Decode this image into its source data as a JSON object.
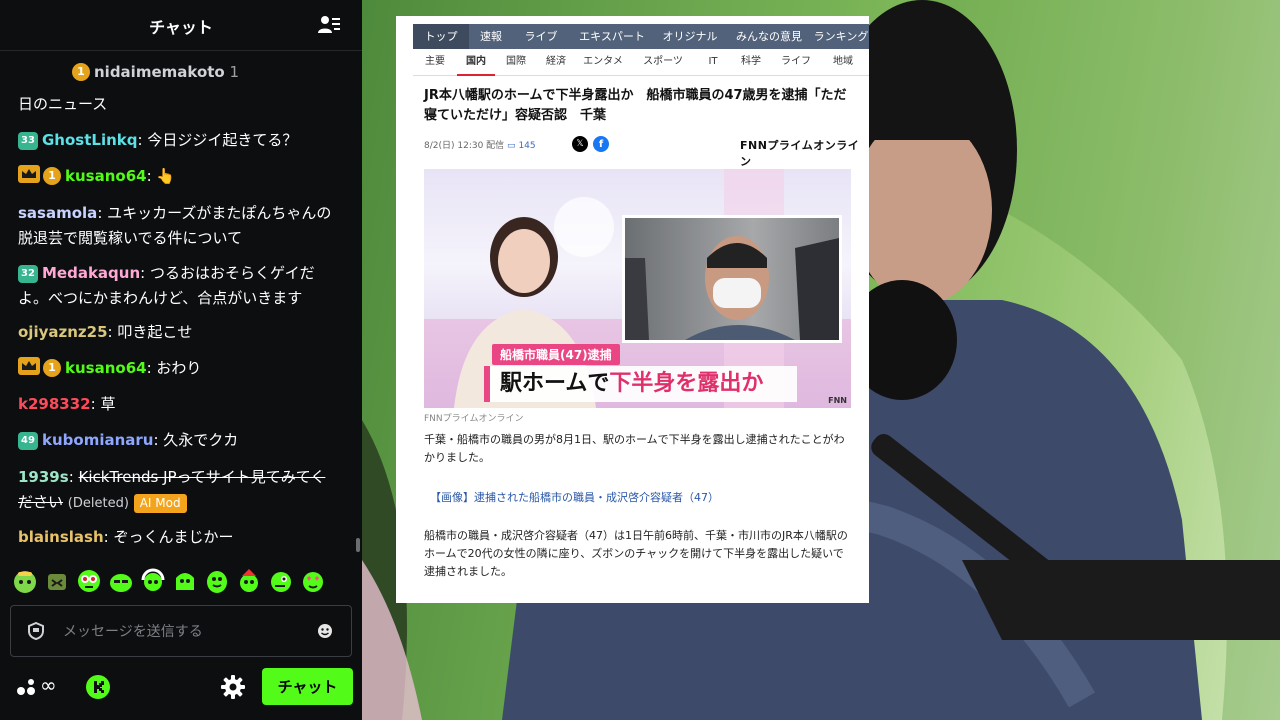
{
  "chat": {
    "title": "チャット",
    "messages": [
      {
        "badges": [
          {
            "type": "gift",
            "text": "1"
          }
        ],
        "user": "nidaimemakoto",
        "user_color": "#cfd3d6",
        "suffix": "1",
        "text": ""
      },
      {
        "badges": [],
        "user": "",
        "user_color": "#ffffff",
        "text": "日のニュース"
      },
      {
        "badges": [
          {
            "type": "sub",
            "text": "33"
          }
        ],
        "user": "GhostLinkq",
        "user_color": "#5ce1e6",
        "text": "今日ジジイ起きてる？"
      },
      {
        "badges": [
          {
            "type": "crown"
          },
          {
            "type": "gift",
            "text": "1"
          }
        ],
        "user": "kusano64",
        "user_color": "#53fc18",
        "text": "👆"
      },
      {
        "badges": [],
        "user": "sasamola",
        "user_color": "#c8d3ff",
        "text": "ユキッカーズがまたぽんちゃんの脱退芸で閲覧稼いでる件について"
      },
      {
        "badges": [
          {
            "type": "sub",
            "text": "32"
          }
        ],
        "user": "Medakaqun",
        "user_color": "#ffa8d5",
        "text": "つるおはおそらくゲイだよ。べつにかまわんけど、合点がいきます"
      },
      {
        "badges": [],
        "user": "ojiyaznz25",
        "user_color": "#d9c77b",
        "text": "叩き起こせ"
      },
      {
        "badges": [
          {
            "type": "crown"
          },
          {
            "type": "gift",
            "text": "1"
          }
        ],
        "user": "kusano64",
        "user_color": "#53fc18",
        "text": "おわり"
      },
      {
        "badges": [],
        "user": "k298332",
        "user_color": "#ff4a5b",
        "text": "草"
      },
      {
        "badges": [
          {
            "type": "sub",
            "text": "49"
          }
        ],
        "user": "kubomianaru",
        "user_color": "#8fa6ff",
        "text": "久永でクカ"
      },
      {
        "badges": [],
        "user": "1939s",
        "user_color": "#9ee6c8",
        "text": "KickTrends JPってサイト見てみてください",
        "deleted_label": "(Deleted)",
        "mod_label": "AI Mod"
      },
      {
        "badges": [],
        "user": "blainslash",
        "user_color": "#e8c16b",
        "text": "ぞっくんまじかー"
      }
    ],
    "emotes": [
      "emote-1",
      "emote-2",
      "emote-3",
      "emote-4",
      "emote-5",
      "emote-6",
      "emote-7",
      "emote-8",
      "emote-9",
      "emote-10"
    ],
    "input_placeholder": "メッセージを送信する",
    "points_label": "∞",
    "send_button": "チャット"
  },
  "article": {
    "nav_primary": [
      "トップ",
      "速報",
      "ライブ",
      "エキスパート",
      "オリジナル",
      "みんなの意見",
      "ランキング"
    ],
    "nav_secondary": [
      "主要",
      "国内",
      "国際",
      "経済",
      "エンタメ",
      "スポーツ",
      "IT",
      "科学",
      "ライフ",
      "地域"
    ],
    "active_primary": "トップ",
    "active_secondary": "国内",
    "headline": "JR本八幡駅のホームで下半身露出か　船橋市職員の47歳男を逮捕「ただ寝ていただけ」容疑否認　千葉",
    "date": "8/2(日) 12:30 配信",
    "comment_count": "145",
    "publisher": "FNNプライムオンライン",
    "photo_caption_small": "船橋市職員(47)逮捕",
    "photo_caption_big_a": "駅ホームで",
    "photo_caption_big_b": "下半身を露出か",
    "photo_mark": "FNN",
    "credit": "FNNプライムオンライン",
    "para1": "千葉・船橋市の職員の男が8月1日、駅のホームで下半身を露出し逮捕されたことがわかりました。",
    "image_link": "【画像】逮捕された船橋市の職員・成沢啓介容疑者（47）",
    "para2": "船橋市の職員・成沢啓介容疑者（47）は1日午前6時前、千葉・市川市のJR本八幡駅のホームで20代の女性の隣に座り、ズボンのチャックを開けて下半身を露出した疑いで逮捕されました。"
  },
  "colors": {
    "kick_green": "#53fc18",
    "nav_bg": "#52627a",
    "caption_pink": "#e94683"
  }
}
